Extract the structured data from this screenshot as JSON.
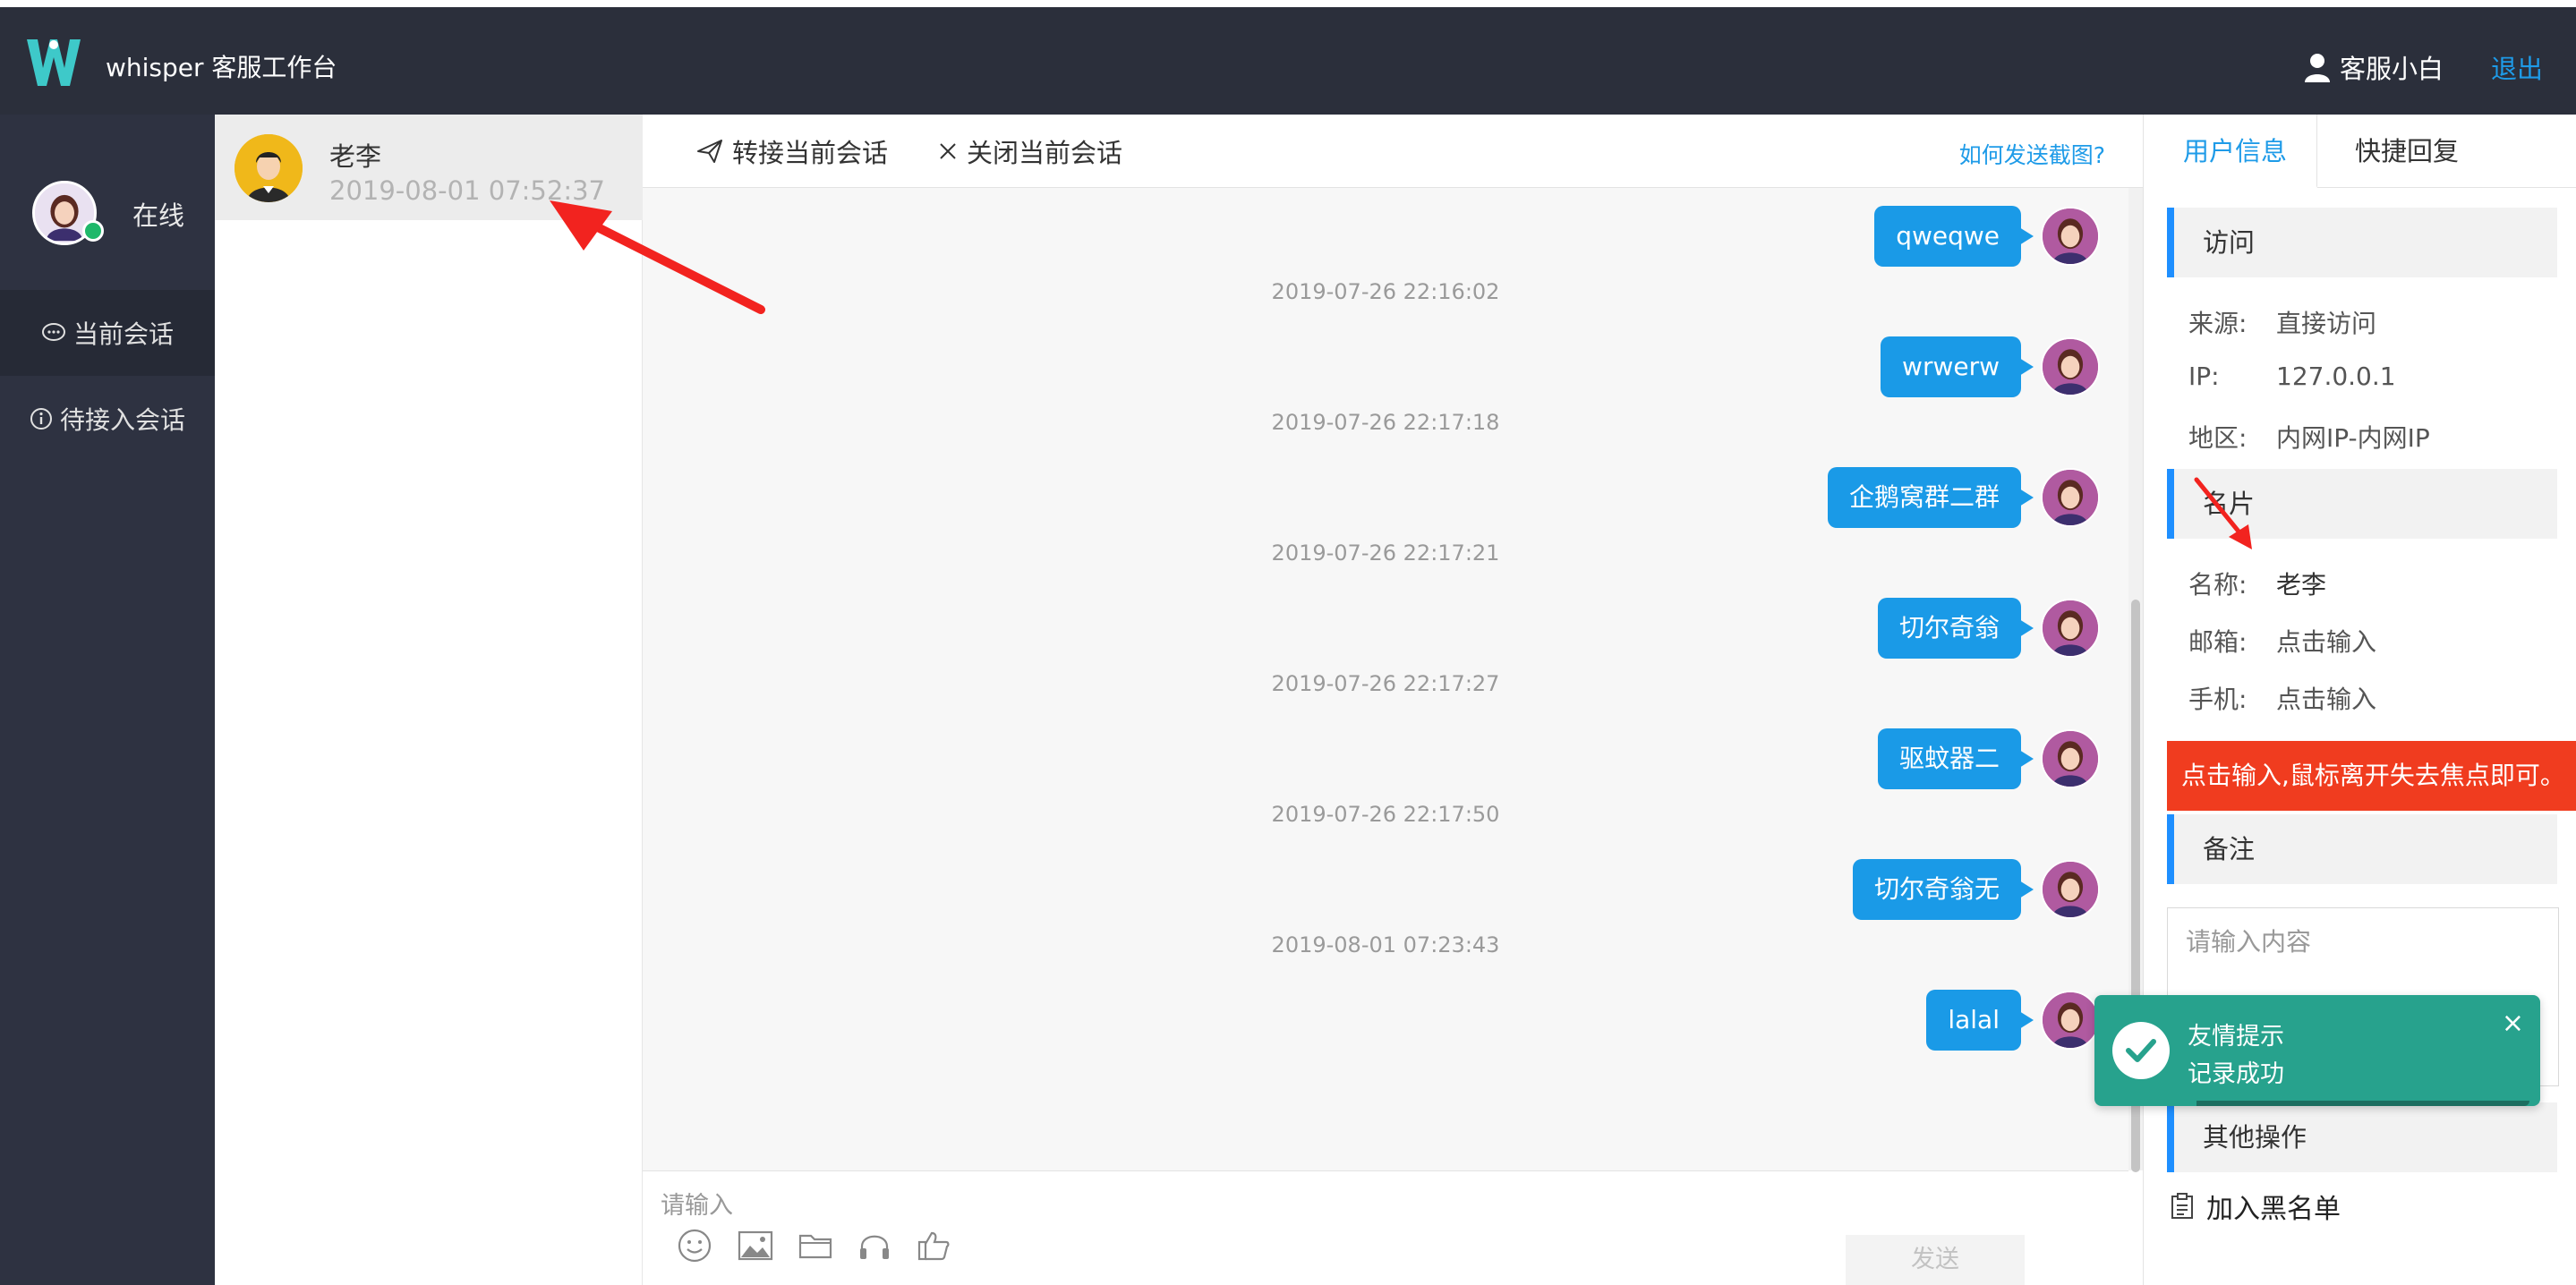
{
  "header": {
    "app_title": "whisper 客服工作台",
    "user_name": "客服小白",
    "logout_label": "退出",
    "logo_letter": "W"
  },
  "sidebar": {
    "status_label": "在线",
    "items": [
      {
        "label": "当前会话",
        "icon": "chat-bubble-icon",
        "active": true
      },
      {
        "label": "待接入会话",
        "icon": "info-icon",
        "active": false
      }
    ]
  },
  "conversations": [
    {
      "name": "老李",
      "time": "2019-08-01 07:52:37",
      "active": true
    }
  ],
  "chat": {
    "transfer_label": "转接当前会话",
    "close_label": "关闭当前会话",
    "help_link": "如何发送截图?",
    "messages": [
      {
        "time": "",
        "text": "qweqwe"
      },
      {
        "time": "2019-07-26 22:16:02",
        "text": "wrwerw"
      },
      {
        "time": "2019-07-26 22:17:18",
        "text": "企鹅窝群二群"
      },
      {
        "time": "2019-07-26 22:17:21",
        "text": "切尔奇翁"
      },
      {
        "time": "2019-07-26 22:17:27",
        "text": "驱蚊器二"
      },
      {
        "time": "2019-07-26 22:17:50",
        "text": "切尔奇翁无"
      },
      {
        "time": "2019-08-01 07:23:43",
        "text": "lalal"
      }
    ],
    "input_placeholder": "请输入",
    "send_label": "发送",
    "tools": [
      "emoji-icon",
      "image-icon",
      "folder-icon",
      "headset-icon",
      "thumbs-up-icon"
    ]
  },
  "right_panel": {
    "tabs": [
      {
        "label": "用户信息",
        "active": true
      },
      {
        "label": "快捷回复",
        "active": false
      }
    ],
    "visit_section": "访问",
    "visit_rows": [
      {
        "key": "来源:",
        "value": "直接访问"
      },
      {
        "key": "IP:",
        "value": "127.0.0.1"
      },
      {
        "key": "地区:",
        "value": "内网IP-内网IP"
      }
    ],
    "card_section": "名片",
    "card_rows": [
      {
        "key": "名称:",
        "value": "老李"
      },
      {
        "key": "邮箱:",
        "value": "点击输入"
      },
      {
        "key": "手机:",
        "value": "点击输入"
      }
    ],
    "tip_banner": "点击输入,鼠标离开失去焦点即可。",
    "remark_section": "备注",
    "remark_placeholder": "请输入内容",
    "other_section": "其他操作",
    "blacklist_label": "加入黑名单"
  },
  "toast": {
    "title": "友情提示",
    "body": "记录成功",
    "close": "×"
  },
  "colors": {
    "header_bg": "#2b2f3b",
    "accent": "#1e9be8",
    "bubble": "#1a9ae7",
    "banner": "#f03c1f",
    "toast": "#27a28d",
    "online": "#1fb86a"
  }
}
